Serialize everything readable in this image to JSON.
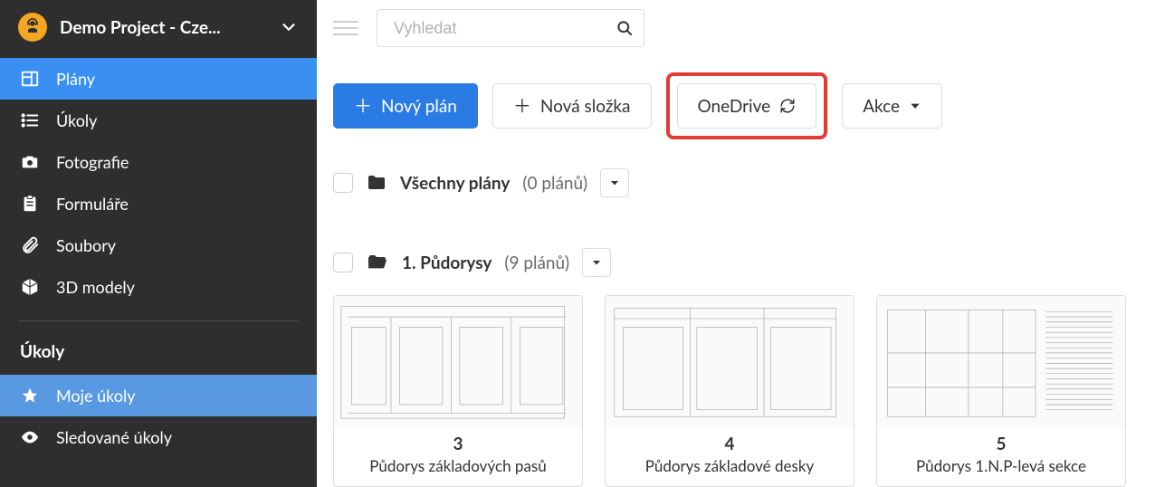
{
  "project": {
    "title": "Demo Project - Cze..."
  },
  "sidebar": {
    "items": [
      {
        "label": "Plány"
      },
      {
        "label": "Úkoly"
      },
      {
        "label": "Fotografie"
      },
      {
        "label": "Formuláře"
      },
      {
        "label": "Soubory"
      },
      {
        "label": "3D modely"
      }
    ],
    "section_title": "Úkoly",
    "subitems": [
      {
        "label": "Moje úkoly"
      },
      {
        "label": "Sledované úkoly"
      }
    ]
  },
  "search": {
    "placeholder": "Vyhledat"
  },
  "toolbar": {
    "new_plan": "Nový plán",
    "new_folder": "Nová složka",
    "onedrive": "OneDrive",
    "actions": "Akce"
  },
  "folders": {
    "all": {
      "name": "Všechny plány",
      "count": "(0 plánů)"
    },
    "group1": {
      "name": "1. Půdorysy",
      "count": "(9 plánů)"
    }
  },
  "cards": [
    {
      "num": "3",
      "title": "Půdorys základových pasů"
    },
    {
      "num": "4",
      "title": "Půdorys základové desky"
    },
    {
      "num": "5",
      "title": "Půdorys 1.N.P-levá sekce"
    }
  ]
}
